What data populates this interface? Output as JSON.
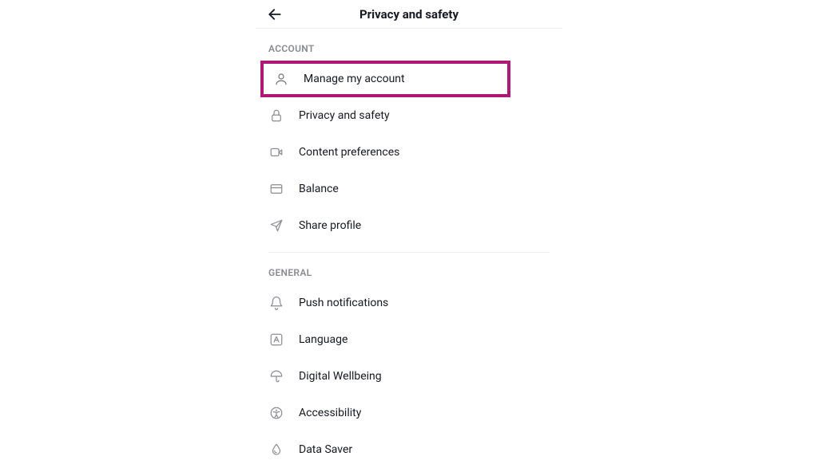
{
  "header": {
    "title": "Privacy and safety"
  },
  "sections": {
    "account": {
      "title": "ACCOUNT",
      "items": {
        "manage_account": {
          "label": "Manage my account"
        },
        "privacy_safety": {
          "label": "Privacy and safety"
        },
        "content_prefs": {
          "label": "Content preferences"
        },
        "balance": {
          "label": "Balance"
        },
        "share_profile": {
          "label": "Share profile"
        }
      }
    },
    "general": {
      "title": "GENERAL",
      "items": {
        "push_notifications": {
          "label": "Push notifications"
        },
        "language": {
          "label": "Language"
        },
        "digital_wellbeing": {
          "label": "Digital Wellbeing"
        },
        "accessibility": {
          "label": "Accessibility"
        },
        "data_saver": {
          "label": "Data Saver"
        }
      }
    }
  },
  "highlight_color": "#b01878"
}
